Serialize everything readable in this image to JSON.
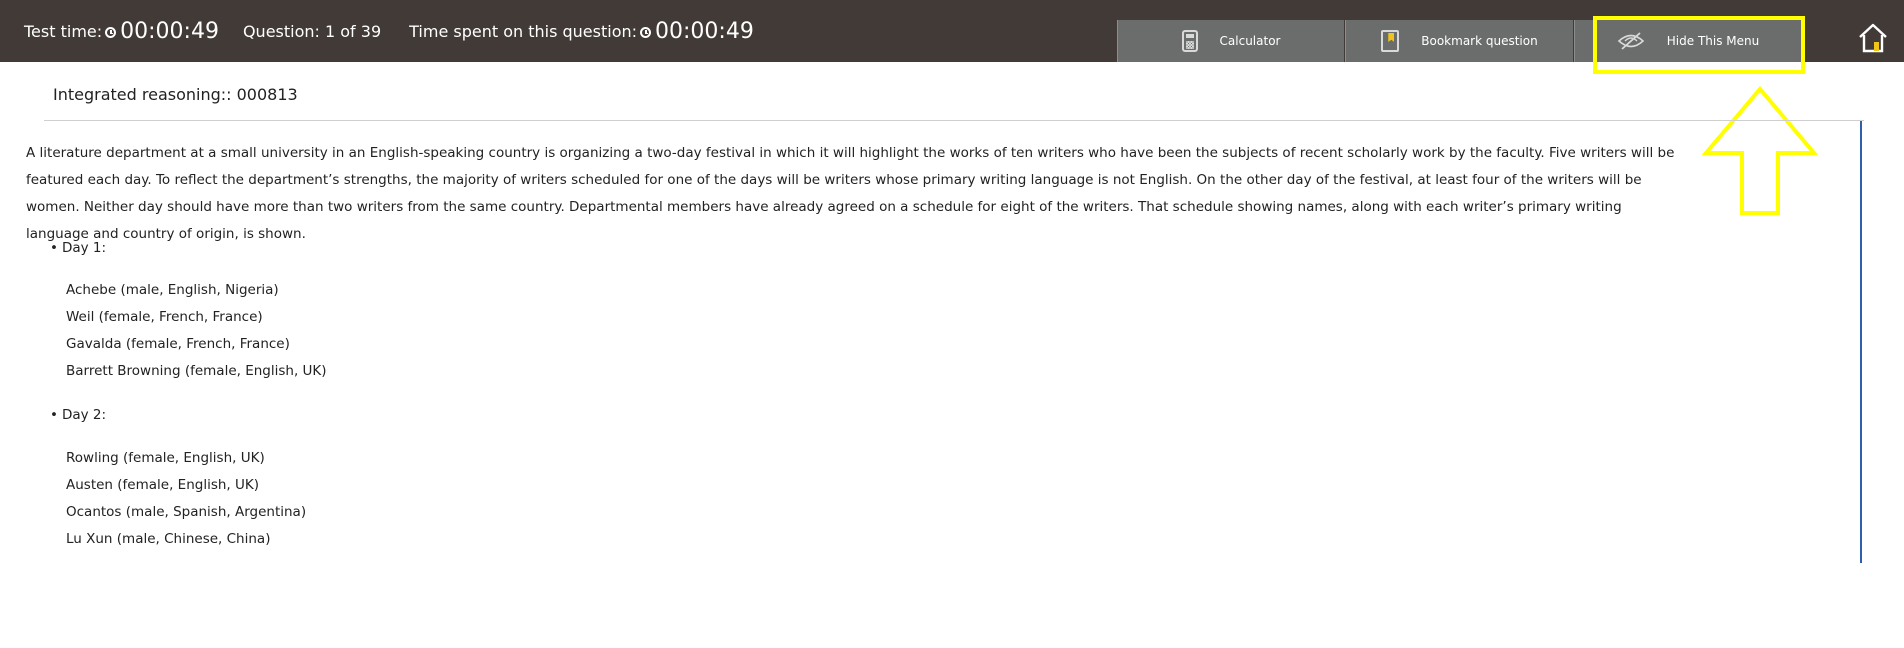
{
  "topbar": {
    "test_time_label": "Test time:",
    "test_time_value": "00:00:49",
    "question_label": "Question: 1 of 39",
    "time_on_question_label": "Time spent on this question:",
    "time_on_question_value": "00:00:49"
  },
  "toolbar": {
    "calculator_label": "Calculator",
    "bookmark_label": "Bookmark question",
    "hide_menu_label": "Hide This Menu"
  },
  "colors": {
    "topbar_bg": "#413a37",
    "button_bg": "#6a6d6c",
    "highlight": "#ffff00",
    "right_rule": "#2f5fa8"
  },
  "content": {
    "section_title": "Integrated reasoning:: 000813",
    "passage": "A literature department at a small university in an English-speaking country is organizing a two-day festival in which it will highlight the works of ten writers who have been the subjects of recent scholarly work by the faculty. Five writers will be featured each day. To reflect the department’s strengths, the majority of writers scheduled for one of the days will be writers whose primary writing language is not English. On the other day of the festival, at least four of the writers will be women. Neither day should have more than two writers from the same country. Departmental members have already agreed on a schedule for eight of the writers. That schedule showing names, along with each writer’s primary writing language and country of origin, is shown.",
    "day1": {
      "heading": "Day 1:",
      "writers": [
        "Achebe (male, English, Nigeria)",
        "Weil (female, French, France)",
        "Gavalda (female, French, France)",
        "Barrett Browning (female, English, UK)"
      ]
    },
    "day2": {
      "heading": "Day 2:",
      "writers": [
        "Rowling (female, English, UK)",
        "Austen (female, English, UK)",
        "Ocantos (male, Spanish, Argentina)",
        "Lu Xun (male, Chinese, China)"
      ]
    }
  }
}
